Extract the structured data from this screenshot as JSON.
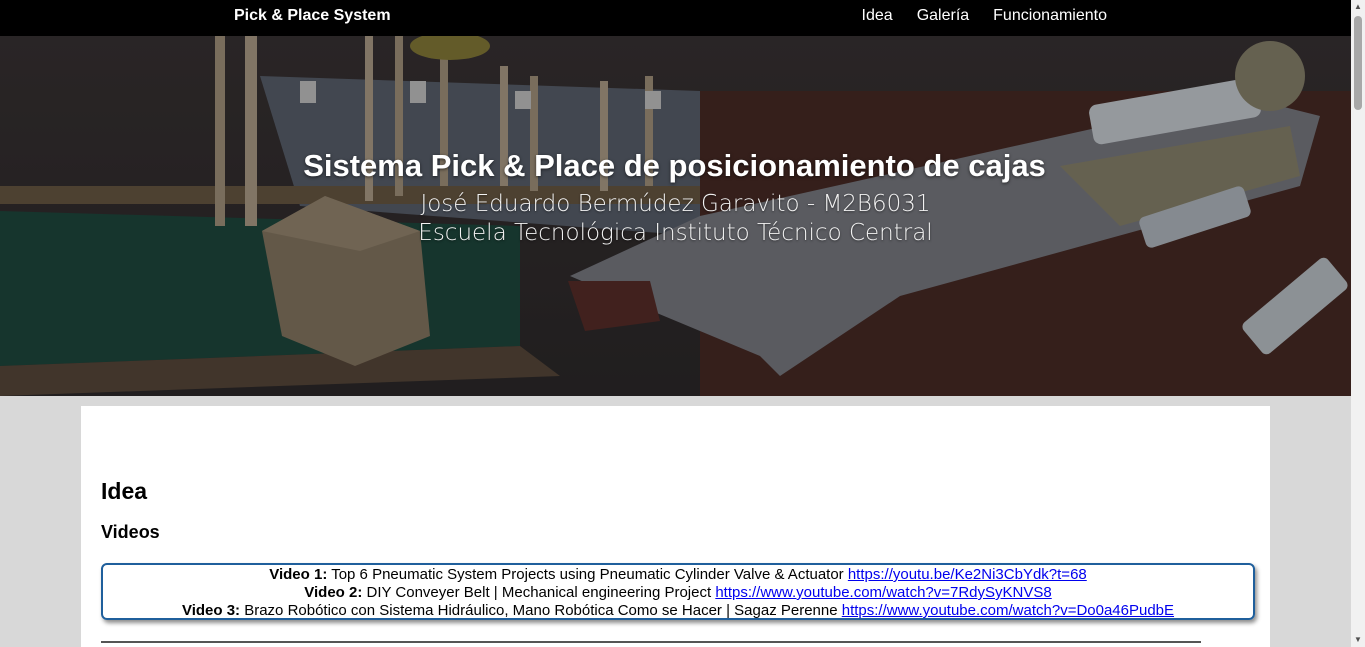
{
  "navbar": {
    "brand": "Pick & Place System",
    "links": [
      "Idea",
      "Galería",
      "Funcionamiento"
    ]
  },
  "hero": {
    "title": "Sistema Pick & Place de posicionamiento de cajas",
    "author": "José Eduardo Bermúdez Garavito - M2B6031",
    "institution": "Escuela Tecnológica Instituto Técnico Central"
  },
  "content": {
    "heading": "Idea",
    "subheading": "Videos",
    "videos": [
      {
        "label": "Video 1:",
        "title": " Top 6 Pneumatic System Projects using Pneumatic Cylinder Valve & Actuator ",
        "url": "https://youtu.be/Ke2Ni3CbYdk?t=68"
      },
      {
        "label": "Video 2:",
        "title": " DIY Conveyer Belt | Mechanical engineering Project ",
        "url": "https://www.youtube.com/watch?v=7RdySyKNVS8"
      },
      {
        "label": "Video 3:",
        "title": " Brazo Robótico con Sistema Hidráulico, Mano Robótica Como se Hacer | Sagaz Perenne ",
        "url": "https://www.youtube.com/watch?v=Do0a46PudbE"
      }
    ]
  },
  "colors": {
    "navbar_bg": "#000000",
    "page_bg": "#d8d8d8",
    "video_border": "#1f5f9c",
    "link": "#0000ee"
  },
  "scrollbar": {
    "up_icon": "triangle-up-icon",
    "down_icon": "triangle-down-icon"
  }
}
